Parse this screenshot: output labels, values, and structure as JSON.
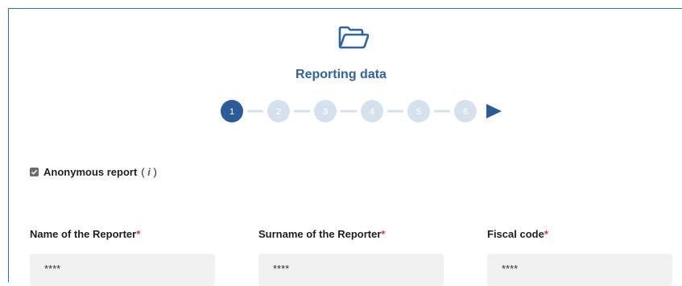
{
  "header": {
    "icon": "folder-open-icon",
    "title": "Reporting data"
  },
  "stepper": {
    "steps": [
      "1",
      "2",
      "3",
      "4",
      "5",
      "6"
    ],
    "active_step": 1,
    "next_icon": "play-arrow-icon",
    "active_color": "#2a5c9a",
    "inactive_color": "#d6e1ee"
  },
  "anonymous": {
    "checked": true,
    "label": "Anonymous report",
    "info_open": "(",
    "info_icon": "i",
    "info_close": ")"
  },
  "fields": [
    {
      "label": "Name of the Reporter",
      "required_mark": "*",
      "value": "****"
    },
    {
      "label": "Surname of the Reporter",
      "required_mark": "*",
      "value": "****"
    },
    {
      "label": "Fiscal code",
      "required_mark": "*",
      "value": "****"
    }
  ]
}
